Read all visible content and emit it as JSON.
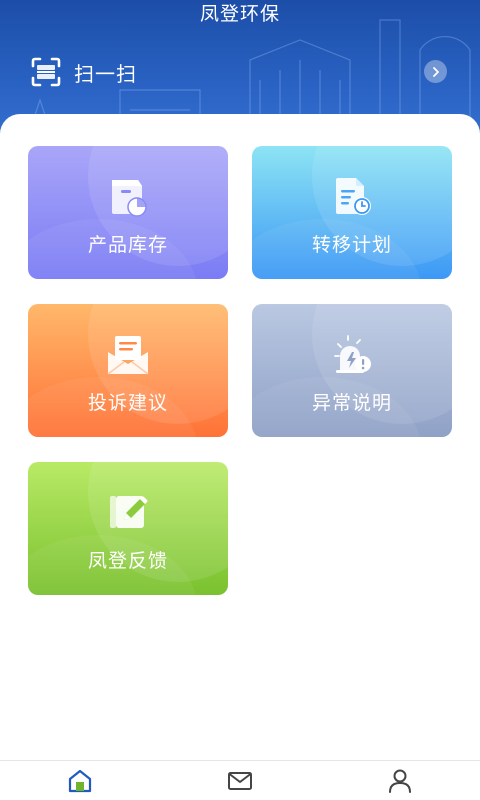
{
  "header": {
    "title": "凤登环保",
    "scan_label": "扫一扫"
  },
  "tiles": [
    {
      "label": "产品库存",
      "icon": "inventory-box-icon"
    },
    {
      "label": "转移计划",
      "icon": "transfer-doc-icon"
    },
    {
      "label": "投诉建议",
      "icon": "envelope-icon"
    },
    {
      "label": "异常说明",
      "icon": "alert-icon"
    },
    {
      "label": "凤登反馈",
      "icon": "edit-feedback-icon"
    }
  ],
  "tabbar": {
    "items": [
      {
        "icon": "home-icon",
        "active": true
      },
      {
        "icon": "mail-icon",
        "active": false
      },
      {
        "icon": "user-icon",
        "active": false
      }
    ]
  },
  "colors": {
    "header": "#2a63c4",
    "active_tab": "#1e5bbf",
    "inactive_tab": "#444444"
  }
}
